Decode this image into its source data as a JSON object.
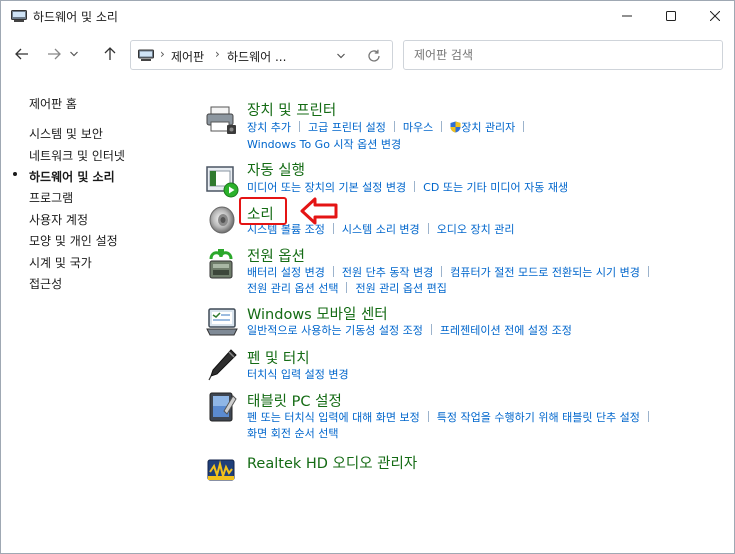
{
  "window": {
    "title": "하드웨어 및 소리"
  },
  "nav": {
    "breadcrumb": [
      "제어판",
      "하드웨어 ..."
    ],
    "search_placeholder": "제어판 검색"
  },
  "sidebar": {
    "items": [
      {
        "label": "제어판 홈",
        "current": false
      },
      {
        "label": "시스템 및 보안",
        "current": false
      },
      {
        "label": "네트워크 및 인터넷",
        "current": false
      },
      {
        "label": "하드웨어 및 소리",
        "current": true
      },
      {
        "label": "프로그램",
        "current": false
      },
      {
        "label": "사용자 계정",
        "current": false
      },
      {
        "label": "모양 및 개인 설정",
        "current": false
      },
      {
        "label": "시계 및 국가",
        "current": false
      },
      {
        "label": "접근성",
        "current": false
      }
    ]
  },
  "categories": [
    {
      "title": "장치 및 프린터",
      "icon": "printer-icon",
      "links_line1": [
        "장치 추가",
        "고급 프린터 설정",
        "마우스",
        "장치 관리자"
      ],
      "links_line2": [
        "Windows To Go 시작 옵션 변경"
      ]
    },
    {
      "title": "자동 실행",
      "icon": "autoplay-icon",
      "links_line1": [
        "미디어 또는 장치의 기본 설정 변경",
        "CD 또는 기타 미디어 자동 재생"
      ]
    },
    {
      "title": "소리",
      "icon": "speaker-icon",
      "links_line1": [
        "시스템 볼륨 조정",
        "시스템 소리 변경",
        "오디오 장치 관리"
      ]
    },
    {
      "title": "전원 옵션",
      "icon": "power-options-icon",
      "links_line1": [
        "배터리 설정 변경",
        "전원 단추 동작 변경",
        "컴퓨터가 절전 모드로 전환되는 시기 변경"
      ],
      "links_line2": [
        "전원 관리 옵션 선택",
        "전원 관리 옵션 편집"
      ]
    },
    {
      "title": "Windows 모바일 센터",
      "icon": "mobility-center-icon",
      "links_line1": [
        "일반적으로 사용하는 기동성 설정 조정",
        "프레젠테이션 전에 설정 조정"
      ]
    },
    {
      "title": "펜 및 터치",
      "icon": "pen-icon",
      "links_line1": [
        "터치식 입력 설정 변경"
      ]
    },
    {
      "title": "태블릿 PC 설정",
      "icon": "tablet-icon",
      "links_line1": [
        "펜 또는 터치식 입력에 대해 화면 보정",
        "특정 작업을 수행하기 위해 태블릿 단추 설정"
      ],
      "links_line2": [
        "화면 회전 순서 선택"
      ]
    },
    {
      "title": "Realtek HD 오디오 관리자",
      "icon": "realtek-audio-icon"
    }
  ],
  "colors": {
    "category_title": "#146b14",
    "link": "#0066cc",
    "annotation": "#e41414"
  }
}
